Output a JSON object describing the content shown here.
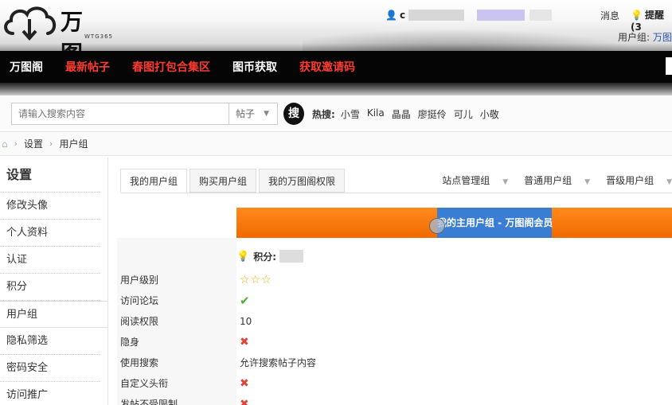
{
  "header": {
    "logo_text": "万图阁",
    "logo_sub": "WTG365",
    "username": "c",
    "messages": "消息",
    "reminders": "提醒(3",
    "usergroup_label": "用户组: ",
    "usergroup_value": "万图"
  },
  "nav": {
    "items": [
      {
        "label": "万图阁"
      },
      {
        "label": "最新帖子"
      },
      {
        "label": "春图打包合集区"
      },
      {
        "label": "图币获取"
      },
      {
        "label": "获取邀请码"
      }
    ]
  },
  "search": {
    "placeholder": "请输入搜索内容",
    "type": "帖子",
    "button": "搜",
    "hot_label": "热搜:",
    "hot_items": [
      "小雪",
      "Kila",
      "晶晶",
      "廖挺伶",
      "可儿",
      "小敬"
    ]
  },
  "breadcrumb": {
    "items": [
      "设置",
      "用户组"
    ]
  },
  "sidebar": {
    "title": "设置",
    "items": [
      {
        "label": "修改头像"
      },
      {
        "label": "个人资料"
      },
      {
        "label": "认证"
      },
      {
        "label": "积分"
      },
      {
        "label": "用户组"
      },
      {
        "label": "隐私筛选"
      },
      {
        "label": "密码安全"
      },
      {
        "label": "访问推广"
      }
    ]
  },
  "tabs": {
    "items": [
      {
        "label": "我的用户组"
      },
      {
        "label": "购买用户组"
      },
      {
        "label": "我的万图阁权限"
      }
    ],
    "groups": [
      {
        "label": "站点管理组"
      },
      {
        "label": "普通用户组"
      },
      {
        "label": "晋级用户组"
      }
    ]
  },
  "banner": {
    "text": "我的主用户组 - 万图阁会员"
  },
  "points": {
    "label": "积分:"
  },
  "permissions": {
    "rows": [
      {
        "label": "用户级别",
        "value": ""
      },
      {
        "label": "访问论坛",
        "value": ""
      },
      {
        "label": "阅读权限",
        "value": "10"
      },
      {
        "label": "隐身",
        "value": ""
      },
      {
        "label": "使用搜索",
        "value": "允许搜索帖子内容"
      },
      {
        "label": "自定义头衔",
        "value": ""
      },
      {
        "label": "发帖不受限制",
        "value": ""
      }
    ]
  },
  "colors": {
    "nav_red": "#ff3b2f",
    "banner_orange": "#f06a00",
    "banner_blue": "#3a7ed3"
  }
}
